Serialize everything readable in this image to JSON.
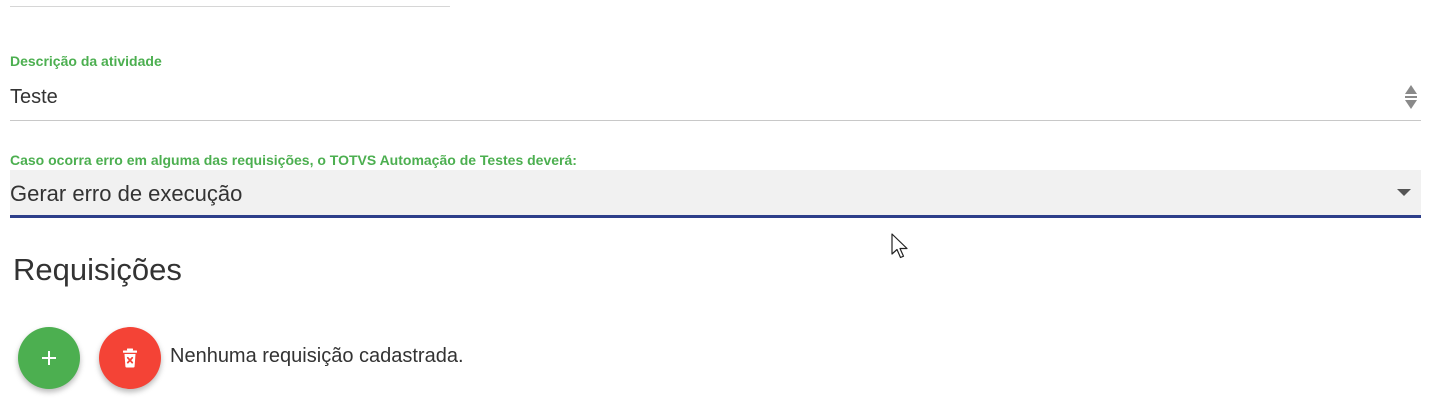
{
  "description_field": {
    "label": "Descrição da atividade",
    "value": "Teste"
  },
  "error_field": {
    "label": "Caso ocorra erro em alguma das requisições, o TOTVS Automação de Testes deverá:",
    "selected": "Gerar erro de execução"
  },
  "requests_section": {
    "title": "Requisições",
    "add_button_label": "+",
    "delete_button_icon": "trash-icon",
    "empty_message": "Nenhuma requisição cadastrada."
  },
  "colors": {
    "label_green": "#4caf50",
    "add_button": "#4caf50",
    "delete_button": "#f44336",
    "select_underline": "#2d3f8a"
  }
}
